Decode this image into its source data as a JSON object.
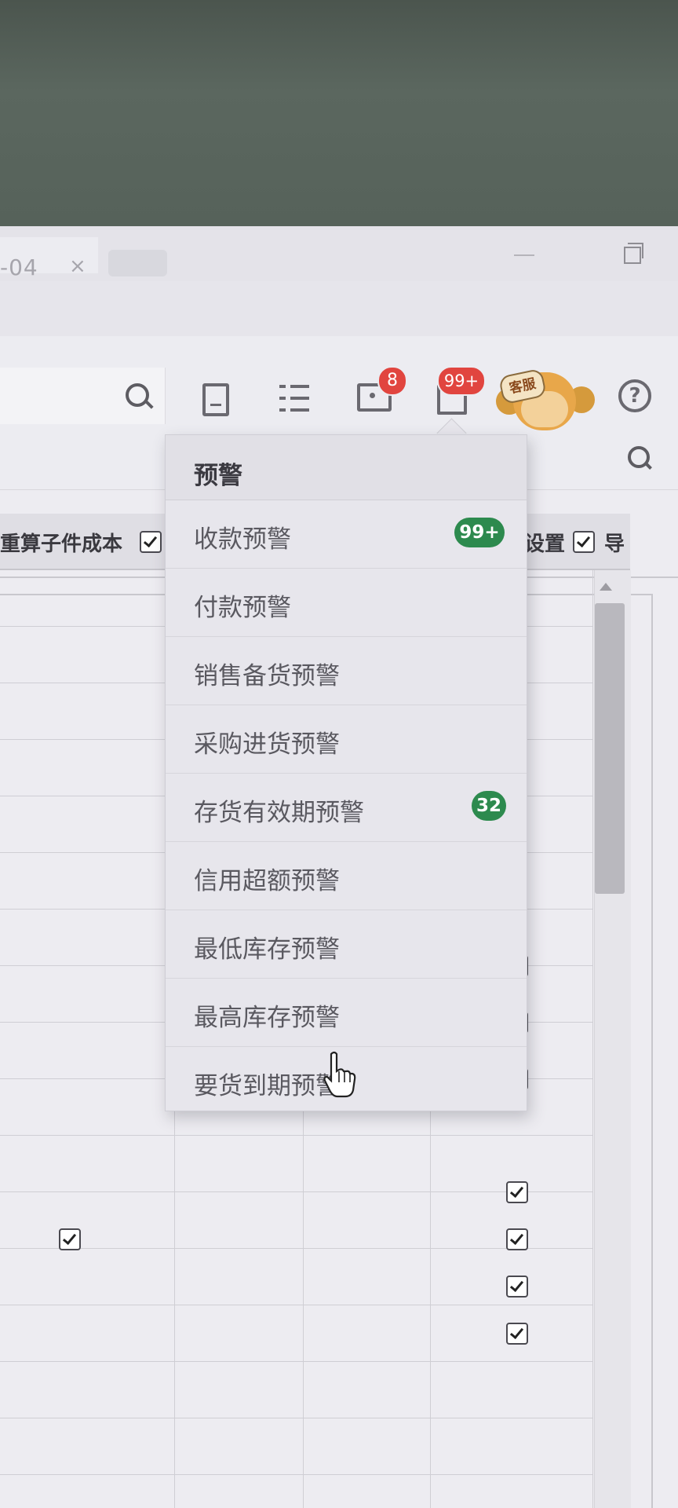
{
  "tab": {
    "label": "-04",
    "close": "×"
  },
  "toolbar": {
    "messages_badge": "8",
    "alerts_badge": "99+",
    "avatar_tag": "客服",
    "help_glyph": "?"
  },
  "table": {
    "headers": {
      "col_left": "重算子件成本",
      "col_right": "设置",
      "col_far_right": "导"
    }
  },
  "alerts_menu": {
    "title": "预警",
    "items": [
      {
        "label": "收款预警",
        "badge": "99+"
      },
      {
        "label": "付款预警",
        "badge": ""
      },
      {
        "label": "销售备货预警",
        "badge": ""
      },
      {
        "label": "采购进货预警",
        "badge": ""
      },
      {
        "label": "存货有效期预警",
        "badge": "32"
      },
      {
        "label": "信用超额预警",
        "badge": ""
      },
      {
        "label": "最低库存预警",
        "badge": ""
      },
      {
        "label": "最高库存预警",
        "badge": ""
      },
      {
        "label": "要货到期预警",
        "badge": ""
      }
    ]
  },
  "colors": {
    "badge_red": "#e1453f",
    "badge_green": "#2d8a4e"
  }
}
